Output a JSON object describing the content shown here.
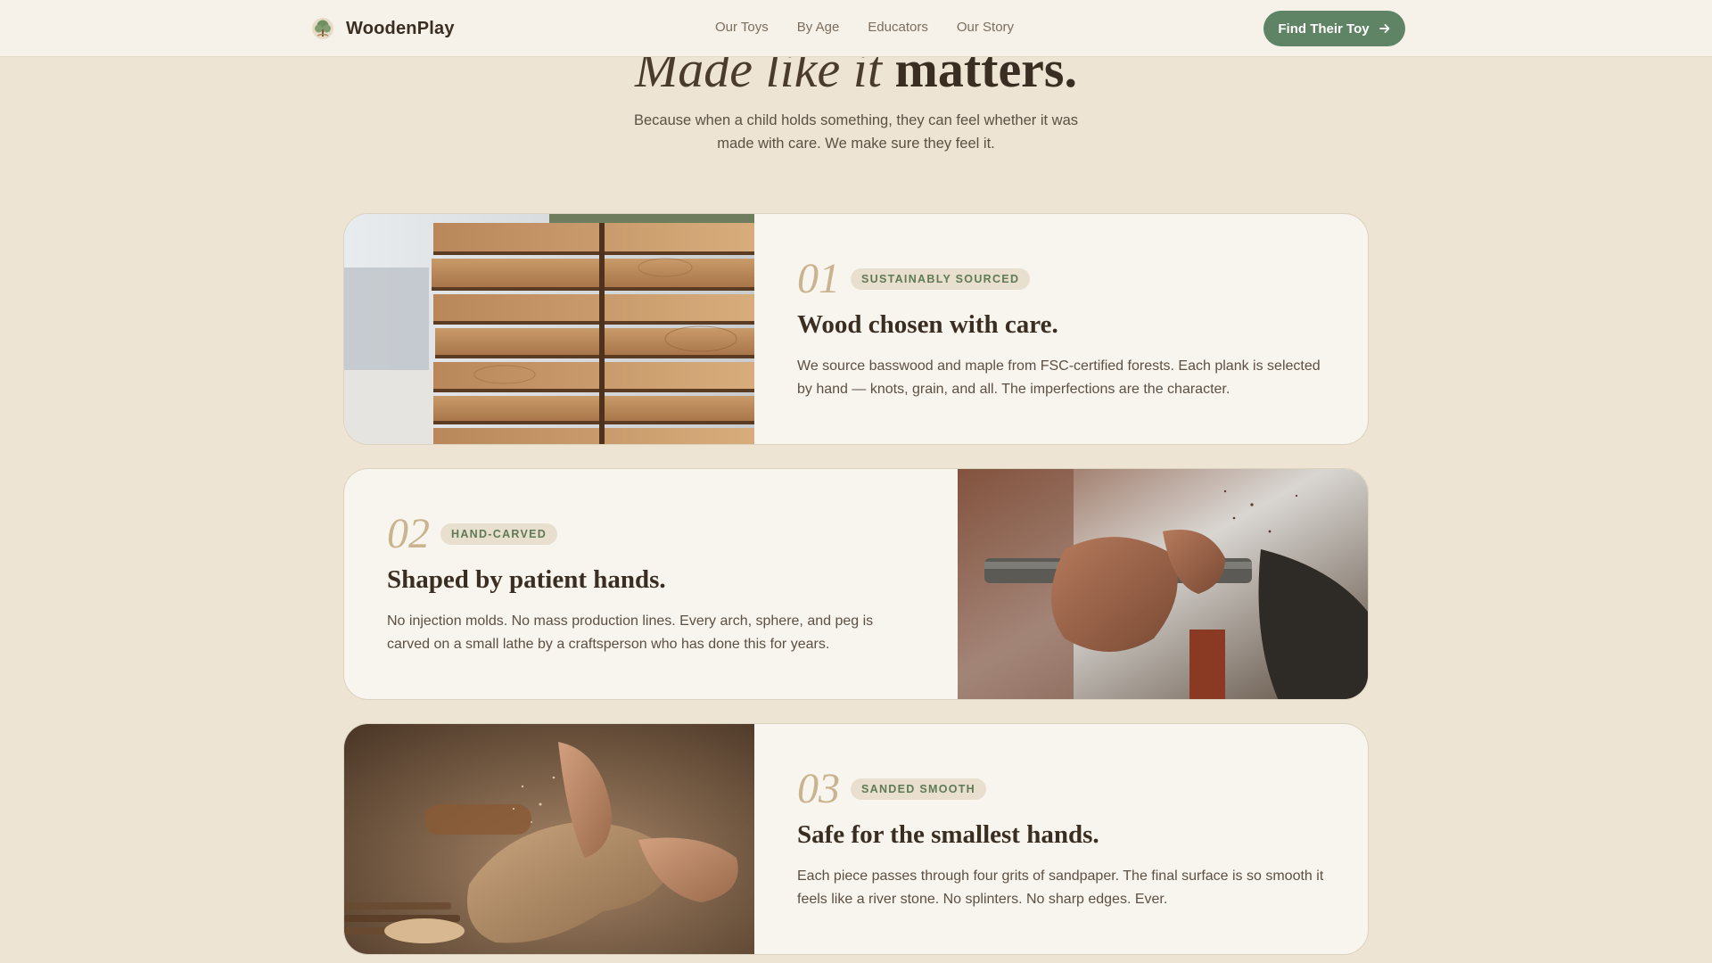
{
  "nav": {
    "brand": "WoodenPlay",
    "links": [
      "Our Toys",
      "By Age",
      "Educators",
      "Our Story"
    ],
    "cta": "Find Their Toy"
  },
  "hero": {
    "title_italic": "Made like it",
    "title_bold": "matters.",
    "subtitle": "Because when a child holds something, they can feel whether it was made with care. We make sure they feel it."
  },
  "features": [
    {
      "number": "01",
      "tag": "SUSTAINABLY SOURCED",
      "title": "Wood chosen with care.",
      "description": "We source basswood and maple from FSC-certified forests. Each plank is selected by hand — knots, grain, and all. The imperfections are the character."
    },
    {
      "number": "02",
      "tag": "HAND-CARVED",
      "title": "Shaped by patient hands.",
      "description": "No injection molds. No mass production lines. Every arch, sphere, and peg is carved on a small lathe by a craftsperson who has done this for years."
    },
    {
      "number": "03",
      "tag": "SANDED SMOOTH",
      "title": "Safe for the smallest hands.",
      "description": "Each piece passes through four grits of sandpaper. The final surface is so smooth it feels like a river stone. No splinters. No sharp edges. Ever."
    }
  ],
  "colors": {
    "page_bg": "#ede4d3",
    "card_bg": "#f8f4ee",
    "accent_green": "#5f8465",
    "number_gold": "#c9b48f",
    "text_dark": "#3a2e22"
  },
  "icons": {
    "brand": "tree-logo-icon",
    "cta": "arrow-right-icon"
  }
}
